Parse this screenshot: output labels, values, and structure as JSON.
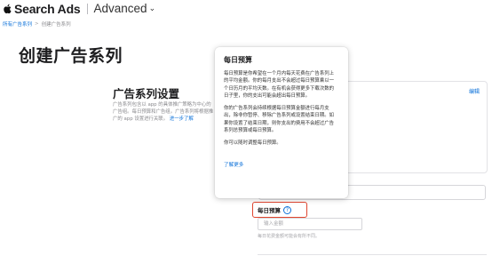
{
  "header": {
    "brand": "Search Ads",
    "mode": "Advanced",
    "mode_caret": "⌄",
    "apple_icon": "apple-logo-icon"
  },
  "breadcrumb": {
    "parent": "所有广告系列",
    "separator": ">",
    "current": "创建广告系列"
  },
  "page": {
    "title": "创建广告系列"
  },
  "section": {
    "title": "广告系列设置",
    "description": "广告系列包含以 app 的具体推广策略为中心的广告组。每日预算和广告组。广告系列将根据推广的 app 设置进行关联。",
    "learn_more": "进一步了解",
    "edit_label": "编辑"
  },
  "budget": {
    "label": "每日预算",
    "help_glyph": "?",
    "placeholder": "输入金额",
    "hint": "每日花费金额可能会有所不同。"
  },
  "popover": {
    "title": "每日预算",
    "paragraphs": [
      "每日预算是你希望在一个月内每天花费在广告系列上的平均金额。你的每月支出不会超过每日预算乘以一个日历月的平均天数。在有机会获得更多下载次数的日子里，你的支出可能会超出每日预算。",
      "你的广告系列会持续根据每日预算金额进行每月支出，除非你暂停、移除广告系列或设置结束日期。如果你设置了结束日期，则你支出的费用不会超过广告系列总预算或每日预算。",
      "你可以随时调整每日预算。"
    ],
    "link": "了解更多"
  },
  "colors": {
    "accent": "#0a70d9",
    "highlight": "#e0452f"
  }
}
